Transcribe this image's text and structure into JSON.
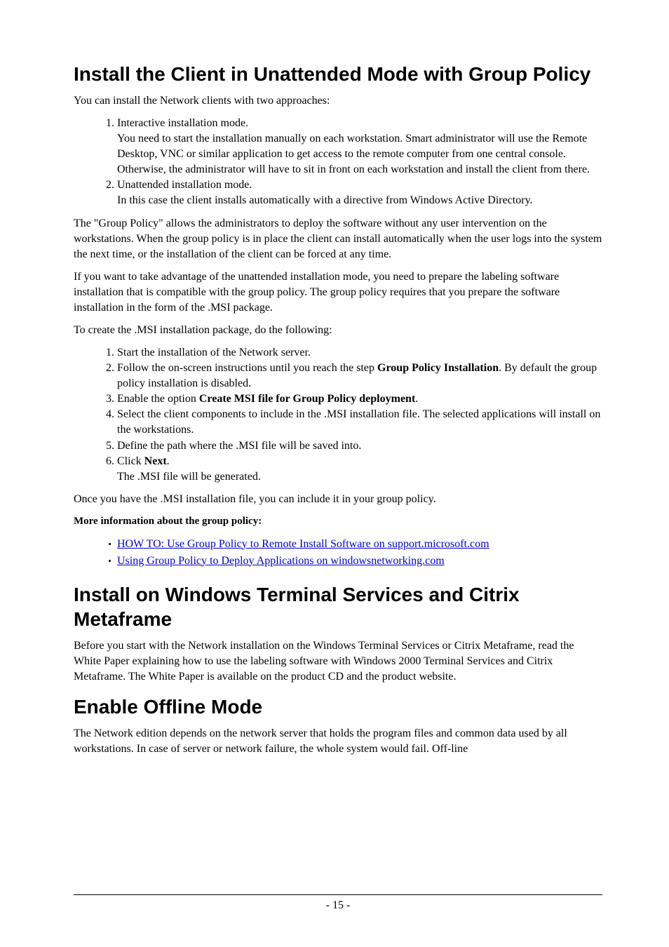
{
  "section1": {
    "title": "Install the Client in Unattended Mode with Group Policy",
    "intro": "You can install the Network clients with two approaches:",
    "list1": {
      "item1_title": "Interactive installation mode.",
      "item1_body": " You need to start the installation manually on each workstation. Smart administrator will use the Remote Desktop, VNC or similar application to get access to the remote computer from one central console. Otherwise, the administrator will have to sit in front on each workstation and install the client from there.",
      "item2_title": "Unattended installation mode.",
      "item2_body": " In this case the client installs automatically with a directive from Windows Active Directory."
    },
    "para2": "The \"Group Policy\" allows the administrators to deploy the software without any user intervention on the workstations. When the group policy is in place the client can install automatically when the user logs into the system the next time, or the installation of the client can be forced at any time.",
    "para3": "If you want to take advantage of the unattended installation mode, you need to prepare the labeling software installation that is compatible with the group policy. The group policy requires that you prepare the software installation in the form of the .MSI package.",
    "para4": "To create the .MSI installation package, do the following:",
    "list2": {
      "item1": "Start the installation of the Network server.",
      "item2_a": "Follow the on-screen instructions until you reach the step ",
      "item2_b": "Group Policy Installation",
      "item2_c": ". By default the group policy installation is disabled.",
      "item3_a": "Enable the option ",
      "item3_b": "Create MSI file for Group Policy deployment",
      "item3_c": ".",
      "item4": "Select the client components to include in the .MSI installation file. The selected applications will install on the workstations.",
      "item5": "Define the path where the .MSI file will be saved into.",
      "item6_a": "Click ",
      "item6_b": "Next",
      "item6_c": ".",
      "item6_body": " The .MSI file will be generated."
    },
    "para5": "Once you have the .MSI installation file, you can include it in your group policy.",
    "more_info_label": "More information about the group policy:",
    "links": {
      "link1": "HOW TO: Use Group Policy to Remote Install Software on support.microsoft.com",
      "link2": "Using Group Policy to Deploy Applications on windowsnetworking.com"
    }
  },
  "section2": {
    "title": "Install on Windows Terminal Services and Citrix Metaframe",
    "para1": "Before you start with the Network installation on the Windows Terminal Services or Citrix Metaframe, read the White Paper explaining how to use the labeling software with Windows 2000 Terminal Services and Citrix Metaframe. The White Paper is available on the product CD and the product website."
  },
  "section3": {
    "title": "Enable Offline Mode",
    "para1": "The Network edition depends on the network server that holds the program files and common data used by all workstations. In case of server or network failure, the whole system would fail. Off-line"
  },
  "footer": {
    "page_number": "- 15 -"
  }
}
